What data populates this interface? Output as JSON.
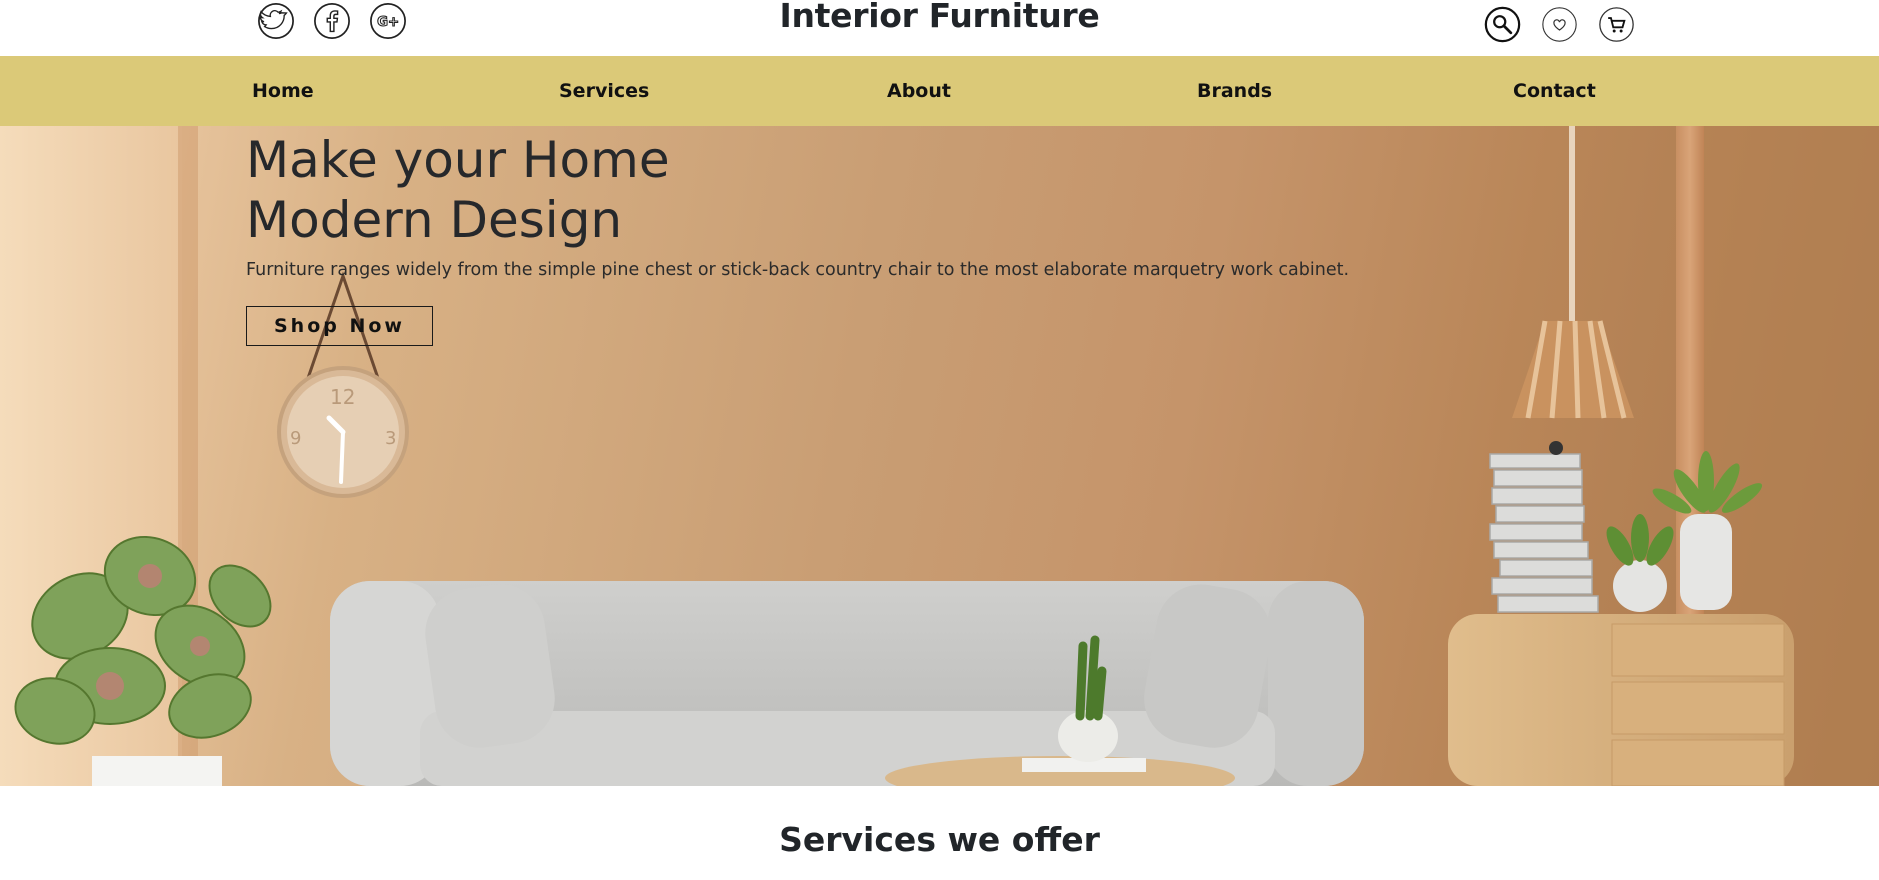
{
  "header": {
    "brand": "Interior Furniture",
    "social_icons": [
      "twitter-icon",
      "facebook-icon",
      "google-plus-icon"
    ],
    "action_icons": [
      "search-icon",
      "heart-icon",
      "cart-icon"
    ]
  },
  "nav": {
    "items": [
      {
        "label": "Home"
      },
      {
        "label": "Services"
      },
      {
        "label": "About"
      },
      {
        "label": "Brands"
      },
      {
        "label": "Contact"
      }
    ],
    "background": "#dbc978"
  },
  "hero": {
    "title_line1": "Make your Home",
    "title_line2": "Modern Design",
    "subtitle": "Furniture ranges widely from the simple pine chest or stick-back country chair to the most elaborate marquetry work cabinet.",
    "cta_label": "Shop Now"
  },
  "services": {
    "heading": "Services we offer"
  }
}
